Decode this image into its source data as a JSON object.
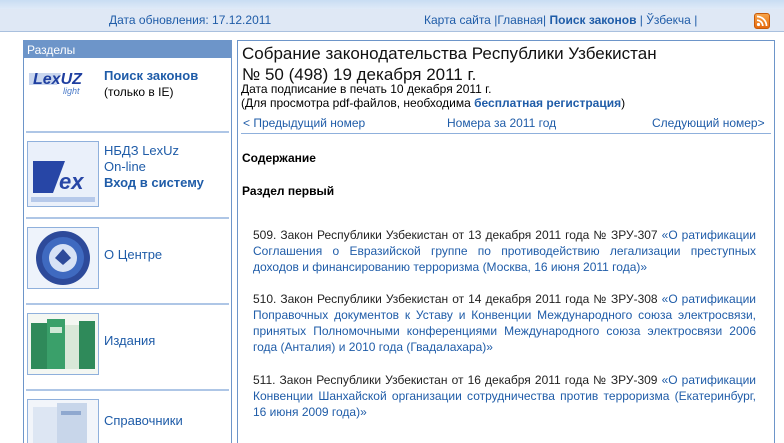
{
  "topbar": {
    "date": "Дата обновления: 17.12.2011",
    "sitemap": "Карта сайта",
    "home": "Главная",
    "search": "Поиск законов",
    "uzbek": "Ўзбекча",
    "sep": "|"
  },
  "sidebar": {
    "header": "Разделы",
    "lexuz_light": {
      "logo_text": "LexUZ light",
      "title": "Поиск законов",
      "subtitle": "(только в IE)"
    },
    "online": {
      "line1": "НБДЗ LexUz",
      "line2": "On-line",
      "line3": "Вход в систему"
    },
    "about": "О Центре",
    "publications": "Издания",
    "reference": "Справочники"
  },
  "main": {
    "title_line1": "Собрание законодательства Республики Узбекистан",
    "title_line2": "№ 50 (498) 19 декабря 2011 г.",
    "signed": "Дата подписание в печать 10 декабря 2011 г.",
    "pdf_note_prefix": "(Для просмотра pdf-файлов, необходима ",
    "pdf_link": "бесплатная регистрация",
    "pdf_note_suffix": ")",
    "prev": "< Предыдущий номер",
    "year": "Номера за 2011 год",
    "next": "Следующий номер>",
    "contents": "Содержание",
    "section": "Раздел первый",
    "laws": [
      {
        "text": "509. Закон Республики Узбекистан от 13 декабря 2011 года № ЗРУ-307 ",
        "link": "«О ратификации Соглашения о Евразийской группе по противодействию легализации преступных доходов и финансированию терроризма (Москва, 16 июня 2011 года)»"
      },
      {
        "text": "510. Закон Республики Узбекистан от 14 декабря 2011 года № ЗРУ-308 ",
        "link": "«О ратификации Поправочных документов к Уставу и Конвенции Международного союза электросвязи, принятых Полномочными конференциями Международного союза электросвязи 2006 года (Анталия) и 2010 года (Гвадалахара)»"
      },
      {
        "text": "511. Закон Республики Узбекистан от 16 декабря 2011 года № ЗРУ-309 ",
        "link": "«О ратификации Конвенции Шанхайской организации сотрудничества против терроризма (Екатеринбург, 16 июня 2009 года)»"
      }
    ]
  },
  "colors": {
    "accent": "#1f5ca8",
    "border": "#6d95c9",
    "rss": "#e66a0f"
  },
  "icons": {
    "rss": "rss-icon"
  }
}
